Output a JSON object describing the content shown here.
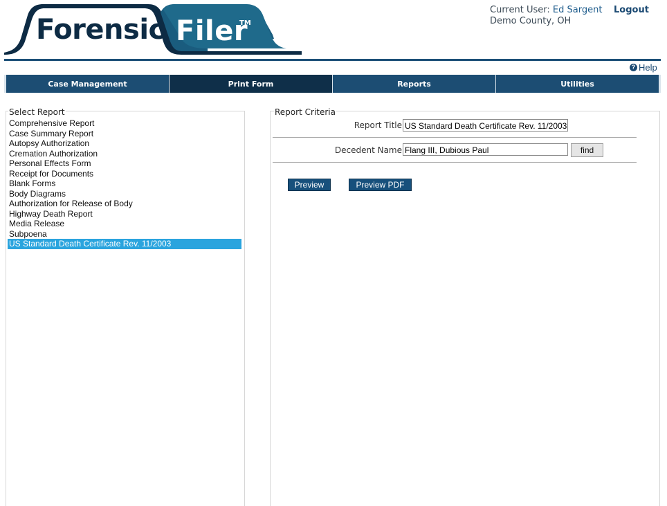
{
  "branding": {
    "logo_word1": "Forensic",
    "logo_word2": "Filer",
    "logo_mark": "TM"
  },
  "user": {
    "current_user_label": "Current User:",
    "current_user_name": "Ed Sargent",
    "county": "Demo County, OH",
    "logout_label": "Logout"
  },
  "help": {
    "icon": "help-circle-icon",
    "label": "Help"
  },
  "nav": {
    "tabs": [
      {
        "label": "Case Management",
        "active": false
      },
      {
        "label": "Print Form",
        "active": true
      },
      {
        "label": "Reports",
        "active": false
      },
      {
        "label": "Utilities",
        "active": false
      }
    ]
  },
  "select_report": {
    "legend": "Select Report",
    "items": [
      "Comprehensive Report",
      "Case Summary Report",
      "Autopsy Authorization",
      "Cremation Authorization",
      "Personal Effects Form",
      "Receipt for Documents",
      "Blank Forms",
      "Body Diagrams",
      "Authorization for Release of Body",
      "Highway Death Report",
      "Media Release",
      "Subpoena",
      "US Standard Death Certificate Rev. 11/2003"
    ],
    "selected_index": 12
  },
  "criteria": {
    "legend": "Report Criteria",
    "report_title_label": "Report Title",
    "report_title_value": "US Standard Death Certificate Rev. 11/2003",
    "decedent_label": "Decedent Name",
    "decedent_value": "Flang III, Dubious Paul",
    "find_label": "find",
    "preview_label": "Preview",
    "preview_pdf_label": "Preview PDF"
  },
  "colors": {
    "brand_navy": "#1c4d73",
    "active_tab": "#0f2f49",
    "selection": "#2aa4de"
  }
}
